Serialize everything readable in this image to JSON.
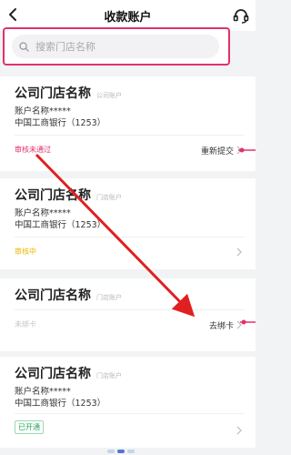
{
  "header": {
    "title": "收款账户"
  },
  "search": {
    "placeholder": "搜索门店名称"
  },
  "accounts": [
    {
      "store_name": "公司门店名称",
      "account_type": "公司账户",
      "account_name": "账户名称*****",
      "bank": "中国工商银行（1253）",
      "status": "审核未通过",
      "action": "重新提交"
    },
    {
      "store_name": "公司门店名称",
      "account_type": "门店账户",
      "account_name": "账户名称*****",
      "bank": "中国工商银行（1253）",
      "status": "审核中",
      "action": ""
    },
    {
      "store_name": "公司门店名称",
      "account_type": "门店账户",
      "account_name": "",
      "bank": "",
      "status": "未绑卡",
      "action": "去绑卡"
    },
    {
      "store_name": "公司门店名称",
      "account_type": "门店账户",
      "account_name": "账户名称*****",
      "bank": "中国工商银行（1253）",
      "status": "已开通",
      "action": ""
    }
  ],
  "colors": {
    "accent_pink": "#e3306a",
    "annotation_red": "#e02020",
    "status_rejected": "#e3306a",
    "status_pending": "#e9b800",
    "status_open": "#1fa75a",
    "pager_active": "#5276d6"
  },
  "icons": {
    "back": "chevron-left-icon",
    "support": "headset-icon",
    "search": "search-icon",
    "row_arrow": "chevron-right-icon"
  }
}
